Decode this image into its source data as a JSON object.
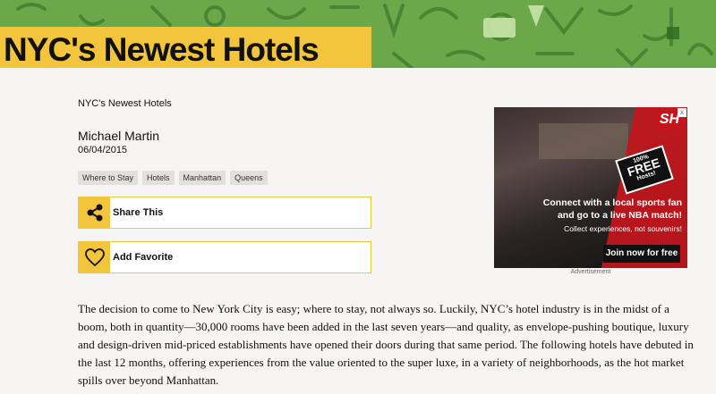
{
  "hero": {
    "title": "NYC's Newest Hotels",
    "bg_color": "#6aa84a",
    "title_bg_color": "#f2c53d"
  },
  "article": {
    "breadcrumb": "NYC's Newest Hotels",
    "author": "Michael Martin",
    "date": "06/04/2015",
    "tags": [
      "Where to Stay",
      "Hotels",
      "Manhattan",
      "Queens"
    ],
    "share_label": "Share This",
    "favorite_label": "Add Favorite",
    "body": "The decision to come to New York City is easy; where to stay, not always so. Luckily, NYC’s hotel industry is in the midst of a boom, both in quantity—30,000 rooms have been added in the last seven years—and quality, as envelope-pushing boutique, luxury and design-driven mid-priced establishments have opened their doors during that same period. The following hotels have debuted in the last 12 months, offering experiences from the value oriented to the super luxe, in a variety of neighborhoods, as the hot market spills over beyond Manhattan."
  },
  "ad": {
    "logo": "SH",
    "badge_pct": "100%",
    "badge_free": "FREE",
    "badge_hosts": "Hosts!",
    "headline": "Connect with a local sports fan and go to a live NBA match!",
    "subline": "Collect experiences, not souvenirs!",
    "cta": "Join now for free",
    "caption": "Advertisement",
    "close": "x",
    "accent_color": "#c3161c"
  },
  "icons": {
    "share": "share-icon",
    "favorite": "heart-icon"
  }
}
